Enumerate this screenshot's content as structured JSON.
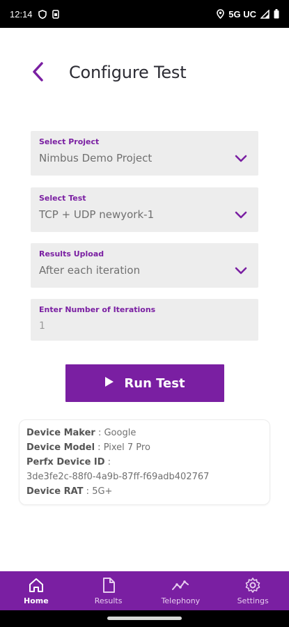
{
  "status_bar": {
    "time": "12:14",
    "network": "5G UC",
    "left_icons": [
      "shield-icon",
      "sim-icon"
    ],
    "right_icons": [
      "location-icon",
      "signal-icon",
      "battery-icon"
    ]
  },
  "header": {
    "title": "Configure Test",
    "back_icon": "chevron-left-icon"
  },
  "form": {
    "project": {
      "label": "Select Project",
      "value": "Nimbus Demo Project"
    },
    "test": {
      "label": "Select Test",
      "value": "TCP + UDP newyork-1"
    },
    "upload": {
      "label": "Results Upload",
      "value": "After each iteration"
    },
    "iterations": {
      "label": "Enter Number of Iterations",
      "value": "1"
    }
  },
  "run_button": {
    "label": "Run Test",
    "icon": "play-icon"
  },
  "device_info": {
    "maker_key": "Device Maker",
    "maker_value": "Google",
    "model_key": "Device Model",
    "model_value": "Pixel 7 Pro",
    "id_key": "Perfx Device ID",
    "id_value": "3de3fe2c-88f0-4a9b-87ff-f69adb402767",
    "rat_key": "Device RAT",
    "rat_value": "5G+"
  },
  "bottom_nav": {
    "home": "Home",
    "results": "Results",
    "telephony": "Telephony",
    "settings": "Settings",
    "active": "home"
  },
  "colors": {
    "accent": "#7a1fa2",
    "field_bg": "#ededed",
    "title_text": "#2b2b33"
  }
}
